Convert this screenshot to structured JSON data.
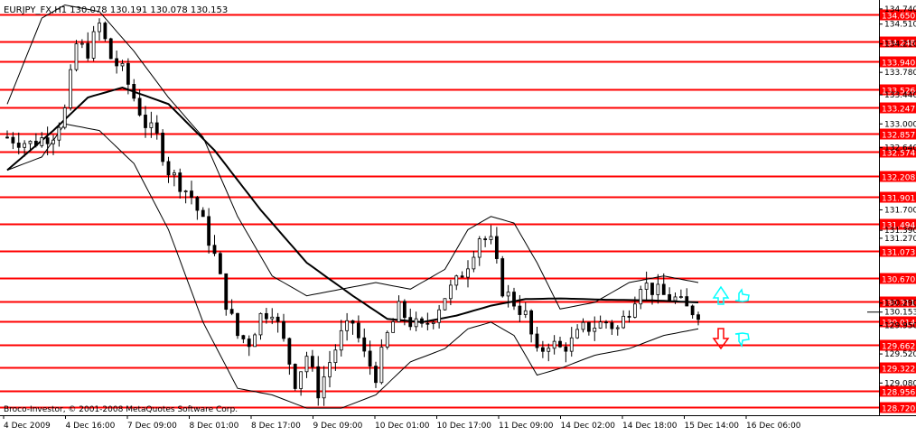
{
  "header": {
    "symbol_line": "EURJPY_FX,H1  130.078 130.191 130.078 130.153"
  },
  "footer": {
    "copyright": "Broco-Investor, © 2001-2008 MetaQuotes Software Corp."
  },
  "colors": {
    "background": "#ffffff",
    "level_line": "#ff0000",
    "level_label_bg": "#ff0000",
    "level_label_text": "#ffffff",
    "candles": "#000000",
    "moving_average": "#000000",
    "bands": "#000000",
    "up_arrow": "#00ffff",
    "down_arrow": "#ff0000",
    "thumb_icon": "#00ffff"
  },
  "icons": [
    "up-arrow-icon",
    "down-arrow-icon",
    "thumbs-up-icon",
    "thumbs-down-icon"
  ],
  "chart_data": {
    "type": "candlestick",
    "title": "EURJPY_FX,H1",
    "ohlc_header": {
      "open": 130.078,
      "high": 130.191,
      "low": 130.078,
      "close": 130.153
    },
    "ylim": [
      128.62,
      134.82
    ],
    "grid": false,
    "x_tick_labels": [
      "4 Dec 2009",
      "4 Dec 16:00",
      "7 Dec 09:00",
      "8 Dec 01:00",
      "8 Dec 17:00",
      "9 Dec 09:00",
      "10 Dec 01:00",
      "10 Dec 17:00",
      "11 Dec 09:00",
      "14 Dec 02:00",
      "14 Dec 18:00",
      "15 Dec 14:00",
      "16 Dec 06:00"
    ],
    "y_tick_labels": [
      "134.740",
      "134.510",
      "134.210",
      "133.780",
      "133.440",
      "133.000",
      "132.640",
      "131.390",
      "131.700",
      "131.270",
      "130.290",
      "130.153",
      "129.950",
      "129.520",
      "129.080"
    ],
    "levels": [
      134.65,
      134.248,
      133.94,
      133.526,
      133.247,
      132.857,
      132.574,
      132.208,
      131.901,
      131.494,
      131.073,
      130.67,
      130.311,
      130.014,
      129.662,
      129.322,
      128.956,
      128.72
    ],
    "current_price": 130.153,
    "close_path": [
      [
        0,
        132.8
      ],
      [
        4,
        132.7
      ],
      [
        8,
        132.85
      ],
      [
        10,
        133.2
      ],
      [
        12,
        134.2
      ],
      [
        14,
        134.1
      ],
      [
        16,
        134.5
      ],
      [
        18,
        134.0
      ],
      [
        20,
        133.8
      ],
      [
        22,
        133.4
      ],
      [
        24,
        133.0
      ],
      [
        26,
        132.8
      ],
      [
        28,
        132.3
      ],
      [
        30,
        132.1
      ],
      [
        32,
        131.9
      ],
      [
        34,
        131.5
      ],
      [
        36,
        131.0
      ],
      [
        38,
        130.3
      ],
      [
        40,
        129.8
      ],
      [
        42,
        129.7
      ],
      [
        44,
        130.1
      ],
      [
        46,
        130.2
      ],
      [
        48,
        129.7
      ],
      [
        50,
        129.1
      ],
      [
        52,
        129.5
      ],
      [
        54,
        128.95
      ],
      [
        56,
        129.4
      ],
      [
        58,
        129.8
      ],
      [
        60,
        130.0
      ],
      [
        62,
        129.5
      ],
      [
        64,
        129.2
      ],
      [
        66,
        129.8
      ],
      [
        68,
        130.2
      ],
      [
        70,
        130.0
      ],
      [
        72,
        129.9
      ],
      [
        74,
        130.1
      ],
      [
        76,
        130.4
      ],
      [
        78,
        130.6
      ],
      [
        80,
        130.9
      ],
      [
        82,
        131.3
      ],
      [
        84,
        131.2
      ],
      [
        86,
        130.5
      ],
      [
        88,
        130.3
      ],
      [
        90,
        130.1
      ],
      [
        92,
        129.5
      ],
      [
        94,
        129.7
      ],
      [
        96,
        129.6
      ],
      [
        98,
        129.7
      ],
      [
        100,
        129.9
      ],
      [
        102,
        129.95
      ],
      [
        104,
        130.0
      ],
      [
        106,
        129.9
      ],
      [
        108,
        130.2
      ],
      [
        110,
        130.6
      ],
      [
        112,
        130.5
      ],
      [
        114,
        130.4
      ],
      [
        116,
        130.35
      ],
      [
        118,
        130.2
      ],
      [
        120,
        130.153
      ]
    ],
    "ma_path": [
      [
        0,
        132.3
      ],
      [
        8,
        132.9
      ],
      [
        14,
        133.4
      ],
      [
        20,
        133.55
      ],
      [
        28,
        133.3
      ],
      [
        36,
        132.6
      ],
      [
        44,
        131.7
      ],
      [
        52,
        130.9
      ],
      [
        60,
        130.4
      ],
      [
        66,
        130.05
      ],
      [
        72,
        130.0
      ],
      [
        78,
        130.1
      ],
      [
        84,
        130.25
      ],
      [
        90,
        130.35
      ],
      [
        96,
        130.36
      ],
      [
        104,
        130.34
      ],
      [
        112,
        130.33
      ],
      [
        120,
        130.3
      ]
    ],
    "band_upper": [
      [
        0,
        133.3
      ],
      [
        6,
        134.6
      ],
      [
        10,
        134.8
      ],
      [
        16,
        134.7
      ],
      [
        22,
        134.1
      ],
      [
        28,
        133.4
      ],
      [
        34,
        132.8
      ],
      [
        40,
        131.6
      ],
      [
        46,
        130.7
      ],
      [
        52,
        130.4
      ],
      [
        58,
        130.5
      ],
      [
        64,
        130.6
      ],
      [
        70,
        130.5
      ],
      [
        76,
        130.8
      ],
      [
        80,
        131.4
      ],
      [
        84,
        131.6
      ],
      [
        88,
        131.5
      ],
      [
        92,
        130.9
      ],
      [
        96,
        130.2
      ],
      [
        102,
        130.3
      ],
      [
        108,
        130.6
      ],
      [
        114,
        130.7
      ],
      [
        120,
        130.6
      ]
    ],
    "band_lower": [
      [
        0,
        132.3
      ],
      [
        6,
        132.5
      ],
      [
        10,
        133.0
      ],
      [
        16,
        132.9
      ],
      [
        22,
        132.4
      ],
      [
        28,
        131.4
      ],
      [
        34,
        130.0
      ],
      [
        40,
        129.0
      ],
      [
        46,
        128.9
      ],
      [
        52,
        128.7
      ],
      [
        58,
        128.7
      ],
      [
        64,
        128.9
      ],
      [
        70,
        129.4
      ],
      [
        76,
        129.6
      ],
      [
        80,
        129.9
      ],
      [
        84,
        130.0
      ],
      [
        88,
        129.8
      ],
      [
        92,
        129.2
      ],
      [
        96,
        129.3
      ],
      [
        102,
        129.5
      ],
      [
        108,
        129.6
      ],
      [
        114,
        129.8
      ],
      [
        120,
        129.9
      ]
    ]
  }
}
